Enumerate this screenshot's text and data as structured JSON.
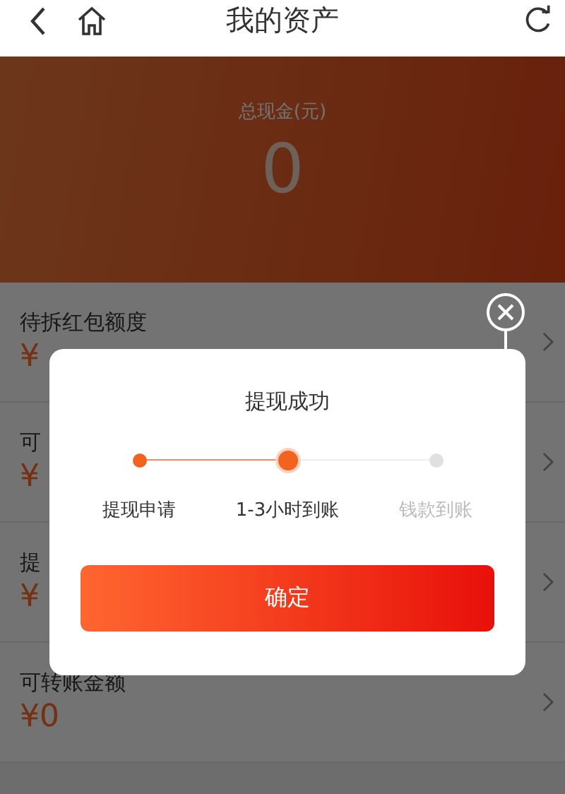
{
  "header": {
    "title": "我的资产"
  },
  "banner": {
    "label": "总现金(元)",
    "amount": "0"
  },
  "rows": [
    {
      "label": "待拆红包额度",
      "value": "¥"
    },
    {
      "label": "可",
      "value": "¥"
    },
    {
      "label": "提",
      "value": "¥"
    },
    {
      "label": "可转账金额",
      "value": "¥0"
    }
  ],
  "dialog": {
    "title": "提现成功",
    "steps": [
      {
        "label": "提现申请",
        "done": true,
        "selected": false
      },
      {
        "label": "1-3小时到账",
        "done": true,
        "selected": true
      },
      {
        "label": "钱款到账",
        "done": false,
        "selected": false
      }
    ],
    "button": "确定"
  }
}
